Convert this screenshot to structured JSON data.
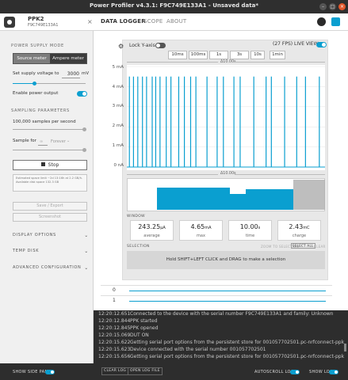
{
  "window": {
    "title": "Power Profiler v4.3.1: F9C749E133A1 - Unsaved data*"
  },
  "header": {
    "device_name": "PPK2",
    "device_serial": "F9C749E133A1",
    "tabs": [
      {
        "label": "DATA LOGGER",
        "active": true
      },
      {
        "label": "SCOPE",
        "active": false
      },
      {
        "label": "ABOUT",
        "active": false
      }
    ]
  },
  "sidebar": {
    "power_supply_mode": {
      "title": "POWER SUPPLY MODE",
      "options": [
        "Source meter",
        "Ampere meter"
      ],
      "selected": "Source meter"
    },
    "supply_voltage": {
      "label": "Set supply voltage to",
      "value": "3000",
      "unit": "mV"
    },
    "enable_output": {
      "label": "Enable power output",
      "on": true
    },
    "sampling": {
      "title": "SAMPLING PARAMETERS",
      "rate_label": "100,000 samples per second",
      "sample_for_label": "Sample for",
      "sample_for_value": "∞",
      "sample_for_unit": "Forever"
    },
    "stop_label": "Stop",
    "info_text": "Estimated space limit ~2d 13:16h at 2.2 GB/h. Available disk space 132.3 GB",
    "save_export_label": "Save / Export",
    "screenshot_label": "Screenshot",
    "collapsibles": [
      "DISPLAY OPTIONS",
      "TEMP DISK",
      "ADVANCED CONFIGURATION"
    ],
    "show_side_panel": "SHOW SIDE PANEL"
  },
  "chart": {
    "lock_y_axis": "Lock Y-axis",
    "fps_text": "(27 FPS)",
    "live_view": "LIVE VIEW",
    "time_buttons": [
      "10ms",
      "100ms",
      "1s",
      "3s",
      "10s",
      "1min"
    ],
    "delta_top": "Δ10.00s",
    "delta_bottom": "Δ10.00s",
    "window_label": "WINDOW",
    "selection_label": "SELECTION",
    "zoom_label": "ZOOM TO SELECTION",
    "select_all_label": "SELECT ALL",
    "clear_label": "CLEAR",
    "selection_hint": "Hold SHIFT+LEFT CLICK and DRAG to make a selection",
    "accent": "#0a9fd0"
  },
  "chart_data": {
    "type": "line",
    "title": "",
    "xlabel": "",
    "ylabel": "",
    "y_ticks": [
      "5 mA",
      "4 mA",
      "3 mA",
      "2 mA",
      "1 mA",
      "0 nA"
    ],
    "ylim": [
      0,
      5
    ],
    "spikes": [
      {
        "time_s": 0.05,
        "peak_ma": 4.5
      },
      {
        "time_s": 0.26,
        "peak_ma": 4.5
      },
      {
        "time_s": 0.48,
        "peak_ma": 4.5
      },
      {
        "time_s": 0.72,
        "peak_ma": 4.5
      },
      {
        "time_s": 0.93,
        "peak_ma": 4.5
      },
      {
        "time_s": 1.22,
        "peak_ma": 4.5
      },
      {
        "time_s": 1.4,
        "peak_ma": 4.5
      },
      {
        "time_s": 1.62,
        "peak_ma": 4.5
      },
      {
        "time_s": 1.94,
        "peak_ma": 4.5
      },
      {
        "time_s": 2.18,
        "peak_ma": 4.5
      },
      {
        "time_s": 2.58,
        "peak_ma": 4.5
      },
      {
        "time_s": 2.87,
        "peak_ma": 4.5
      },
      {
        "time_s": 3.19,
        "peak_ma": 4.5
      },
      {
        "time_s": 3.46,
        "peak_ma": 4.5
      },
      {
        "time_s": 4.03,
        "peak_ma": 4.5
      },
      {
        "time_s": 4.55,
        "peak_ma": 4.5
      },
      {
        "time_s": 4.87,
        "peak_ma": 4.5
      },
      {
        "time_s": 5.41,
        "peak_ma": 4.5
      },
      {
        "time_s": 5.73,
        "peak_ma": 4.5
      },
      {
        "time_s": 6.43,
        "peak_ma": 4.5
      },
      {
        "time_s": 7.06,
        "peak_ma": 4.5
      },
      {
        "time_s": 7.33,
        "peak_ma": 4.5
      },
      {
        "time_s": 8.01,
        "peak_ma": 4.5
      },
      {
        "time_s": 8.63,
        "peak_ma": 4.5
      },
      {
        "time_s": 9.08,
        "peak_ma": 4.5
      },
      {
        "time_s": 9.79,
        "peak_ma": 4.5
      }
    ]
  },
  "stats": [
    {
      "value": "243.25",
      "unit": "μA",
      "caption": "average"
    },
    {
      "value": "4.65",
      "unit": "mA",
      "caption": "max"
    },
    {
      "value": "10.00",
      "unit": "s",
      "caption": "time"
    },
    {
      "value": "2.43",
      "unit": "mC",
      "caption": "charge"
    }
  ],
  "digital_channels": [
    "0",
    "1"
  ],
  "log": {
    "entries": [
      {
        "time": "12:20:12.651",
        "message": "Connected to the device with the serial number F9C749E133A1 and family: Unknown"
      },
      {
        "time": "12:20:12.844",
        "message": "PPK started"
      },
      {
        "time": "12:20:12.845",
        "message": "PPK opened"
      },
      {
        "time": "12:20:15.069",
        "message": "DUT ON"
      },
      {
        "time": "12:20:15.622",
        "message": "Getting serial port options from the persistent store for 001057702501.pc-nrfconnect-ppk"
      },
      {
        "time": "12:20:15.623",
        "message": "Device connected with the serial number 001057702501"
      },
      {
        "time": "12:20:15.656",
        "message": "Getting serial port options from the persistent store for 001057702501.pc-nrfconnect-ppk"
      }
    ]
  },
  "bottom": {
    "clear_log": "CLEAR LOG",
    "open_log_file": "OPEN LOG FILE",
    "autoscroll_log": "AUTOSCROLL LOG",
    "show_log": "SHOW LOG"
  }
}
